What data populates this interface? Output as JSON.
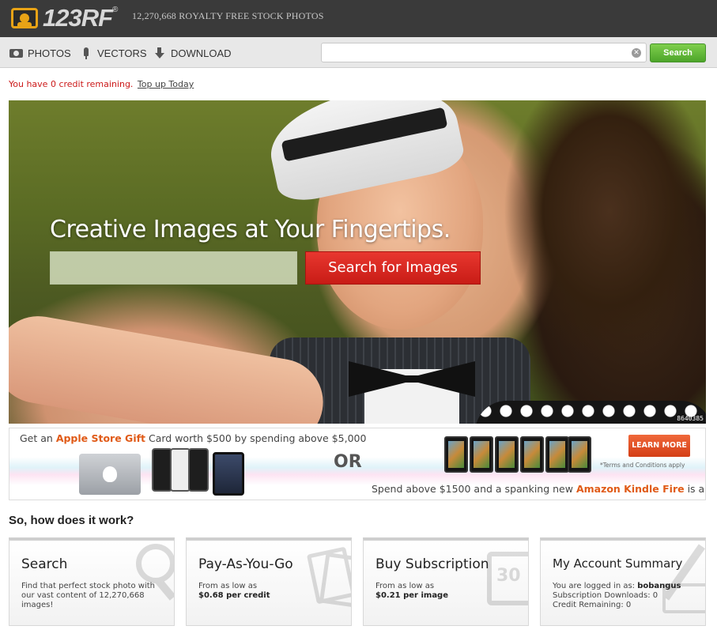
{
  "brand": {
    "logo_text": "123RF",
    "logo_reg": "®",
    "tagline": "12,270,668  ROYALTY FREE STOCK PHOTOS",
    "accent_color": "#e8a316"
  },
  "nav": {
    "items": [
      {
        "label": "PHOTOS",
        "icon": "camera-icon"
      },
      {
        "label": "VECTORS",
        "icon": "pen-nib-icon"
      },
      {
        "label": "DOWNLOAD",
        "icon": "download-arrow-icon"
      }
    ],
    "search": {
      "value": "",
      "placeholder": ""
    },
    "search_button": "Search"
  },
  "credit": {
    "message": "You have 0 credit remaining.",
    "link": "Top up Today"
  },
  "hero": {
    "title": "Creative Images at Your Fingertips.",
    "input_value": "",
    "button": "Search for Images",
    "photo_id": "8640385"
  },
  "banner": {
    "line1_pre": "Get an ",
    "line1_hl": "Apple Store Gift",
    "line1_post": " Card worth $500 by spending above $5,000",
    "or": "OR",
    "learn_more": "LEARN MORE",
    "terms": "*Terms and Conditions apply",
    "line2_pre": "Spend above $1500 and a spanking new ",
    "line2_hl": "Amazon Kindle Fire",
    "line2_post": " is all yours !"
  },
  "how": {
    "title": "So, how does it work?",
    "cards": [
      {
        "title": "Search",
        "text": "Find that perfect stock photo with our vast content of 12,270,668 images!",
        "icon": "magnifier-icon"
      },
      {
        "title": "Pay-As-You-Go",
        "line1": "From as low as",
        "line2": "$0.68 per credit",
        "icon": "image-cards-icon"
      },
      {
        "title": "Buy Subscription",
        "line1": "From as low as",
        "line2": "$0.21 per image",
        "icon": "calendar-icon"
      },
      {
        "title": "My Account Summary",
        "login_label": "You are logged in as: ",
        "username": "bobangus",
        "downloads": "Subscription Downloads: 0",
        "remaining": "Credit Remaining: 0",
        "icon": "pen-paper-icon"
      }
    ]
  }
}
